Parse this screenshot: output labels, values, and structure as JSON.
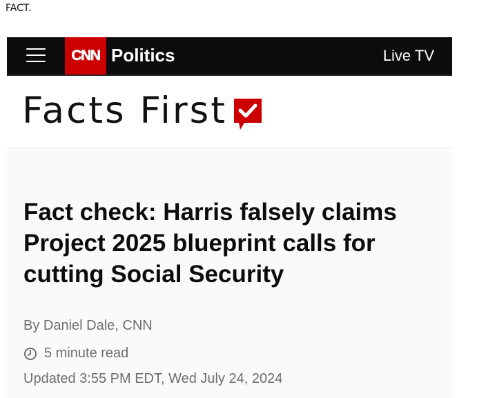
{
  "caption": "FACT.",
  "header": {
    "logo_text": "CNN",
    "section": "Politics",
    "live_tv": "Live TV",
    "colors": {
      "bar": "#0c0c0c",
      "logo": "#cc0000"
    }
  },
  "banner": {
    "title": "Facts First",
    "badge_icon": "checkmark-speech-bubble-icon"
  },
  "article": {
    "headline": "Fact check: Harris falsely claims Project 2025 blueprint calls for cutting Social Security",
    "byline": "By Daniel Dale, CNN",
    "read_time": "5 minute read",
    "updated": "Updated 3:55 PM EDT, Wed July 24, 2024"
  }
}
